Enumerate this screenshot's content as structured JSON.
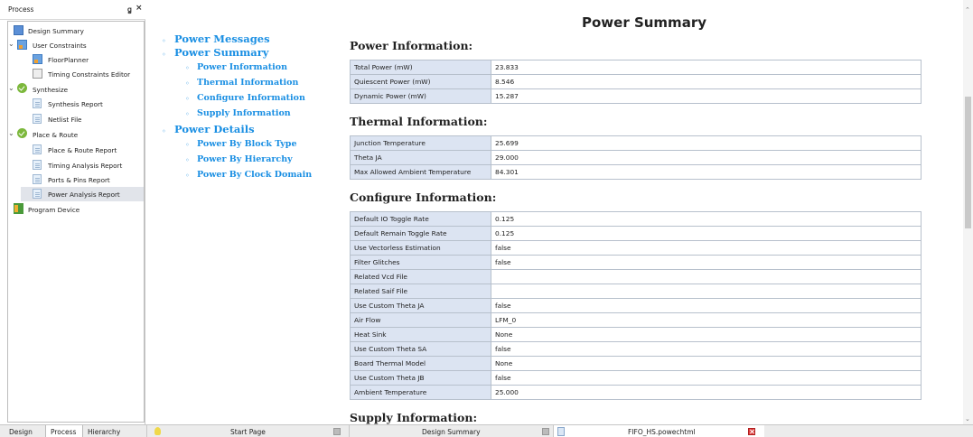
{
  "process_panel": {
    "title": "Process",
    "pin_glyph": "ꬶ",
    "close_glyph": "×",
    "items": [
      {
        "label": "Design Summary",
        "icon": "document-icon"
      },
      {
        "label": "User Constraints",
        "icon": "constraints-icon",
        "expanded": true
      },
      {
        "label": "FloorPlanner",
        "icon": "floorplanner-icon"
      },
      {
        "label": "Timing Constraints Editor",
        "icon": "timing-icon"
      },
      {
        "label": "Synthesize",
        "icon": "check-icon",
        "expanded": true
      },
      {
        "label": "Synthesis Report",
        "icon": "document-icon"
      },
      {
        "label": "Netlist File",
        "icon": "document-icon"
      },
      {
        "label": "Place & Route",
        "icon": "check-icon",
        "expanded": true
      },
      {
        "label": "Place & Route Report",
        "icon": "document-icon"
      },
      {
        "label": "Timing Analysis Report",
        "icon": "document-icon"
      },
      {
        "label": "Ports & Pins Report",
        "icon": "document-icon"
      },
      {
        "label": "Power Analysis Report",
        "icon": "document-icon",
        "selected": true
      },
      {
        "label": "Program Device",
        "icon": "program-icon"
      }
    ]
  },
  "bottom_tabs": {
    "panel_tabs": [
      "Design",
      "Process",
      "Hierarchy"
    ],
    "active_panel_tab": "Process",
    "documents": [
      {
        "label": "Start Page",
        "icon": "lightbulb-icon"
      },
      {
        "label": "Design Summary",
        "icon": "document-icon"
      },
      {
        "label": "FIFO_HS.powechtml",
        "icon": "page-icon",
        "active": true
      }
    ]
  },
  "report": {
    "title": "Power Summary",
    "toc": {
      "power_messages": "Power Messages",
      "power_summary": "Power Summary",
      "power_information": "Power Information",
      "thermal_information": "Thermal Information",
      "configure_information": "Configure Information",
      "supply_information": "Supply Information",
      "power_details": "Power Details",
      "power_by_block_type": "Power By Block Type",
      "power_by_hierarchy": "Power By Hierarchy",
      "power_by_clock_domain": "Power By Clock Domain"
    },
    "sections": {
      "power_information": {
        "title": "Power Information:",
        "rows": [
          {
            "key": "Total Power (mW)",
            "value": "23.833"
          },
          {
            "key": "Quiescent Power (mW)",
            "value": "8.546"
          },
          {
            "key": "Dynamic Power (mW)",
            "value": "15.287"
          }
        ]
      },
      "thermal_information": {
        "title": "Thermal Information:",
        "rows": [
          {
            "key": "Junction Temperature",
            "value": "25.699"
          },
          {
            "key": "Theta JA",
            "value": "29.000"
          },
          {
            "key": "Max Allowed Ambient Temperature",
            "value": "84.301"
          }
        ]
      },
      "configure_information": {
        "title": "Configure Information:",
        "rows": [
          {
            "key": "Default IO Toggle Rate",
            "value": "0.125"
          },
          {
            "key": "Default Remain Toggle Rate",
            "value": "0.125"
          },
          {
            "key": "Use Vectorless Estimation",
            "value": "false"
          },
          {
            "key": "Filter Glitches",
            "value": "false"
          },
          {
            "key": "Related Vcd File",
            "value": ""
          },
          {
            "key": "Related Saif File",
            "value": ""
          },
          {
            "key": "Use Custom Theta JA",
            "value": "false"
          },
          {
            "key": "Air Flow",
            "value": "LFM_0"
          },
          {
            "key": "Heat Sink",
            "value": "None"
          },
          {
            "key": "Use Custom Theta SA",
            "value": "false"
          },
          {
            "key": "Board Thermal Model",
            "value": "None"
          },
          {
            "key": "Use Custom Theta JB",
            "value": "false"
          },
          {
            "key": "Ambient Temperature",
            "value": "25.000"
          }
        ]
      },
      "supply_information": {
        "title": "Supply Information:"
      }
    }
  },
  "colors": {
    "link": "#1a8fe3",
    "table_key_bg": "#dce4f2",
    "check_green": "#7cb83c",
    "close_red": "#e04040"
  }
}
